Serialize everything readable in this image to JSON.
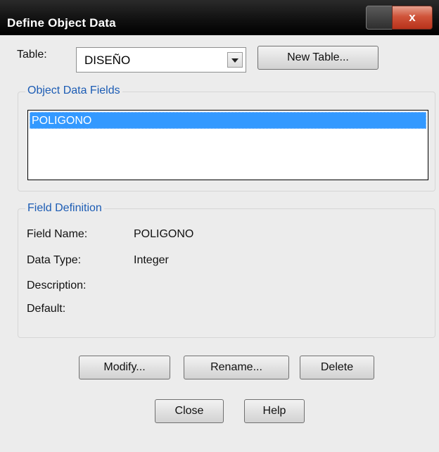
{
  "window": {
    "title": "Define Object Data",
    "close_glyph": "x"
  },
  "table": {
    "label": "Table:",
    "selected": "DISEÑO",
    "new_table_button": "New Table..."
  },
  "object_data_fields": {
    "title": "Object Data Fields",
    "items": [
      "POLIGONO"
    ],
    "selected_index": 0
  },
  "field_definition": {
    "title": "Field Definition",
    "field_name_label": "Field Name:",
    "field_name_value": "POLIGONO",
    "data_type_label": "Data Type:",
    "data_type_value": "Integer",
    "description_label": "Description:",
    "description_value": "",
    "default_label": "Default:",
    "default_value": ""
  },
  "buttons": {
    "modify": "Modify...",
    "rename": "Rename...",
    "delete": "Delete",
    "close": "Close",
    "help": "Help"
  },
  "colors": {
    "accent": "#3399ff",
    "group_title": "#1c5cb4",
    "titlebar": "#111111",
    "close_button": "#c8432a"
  }
}
